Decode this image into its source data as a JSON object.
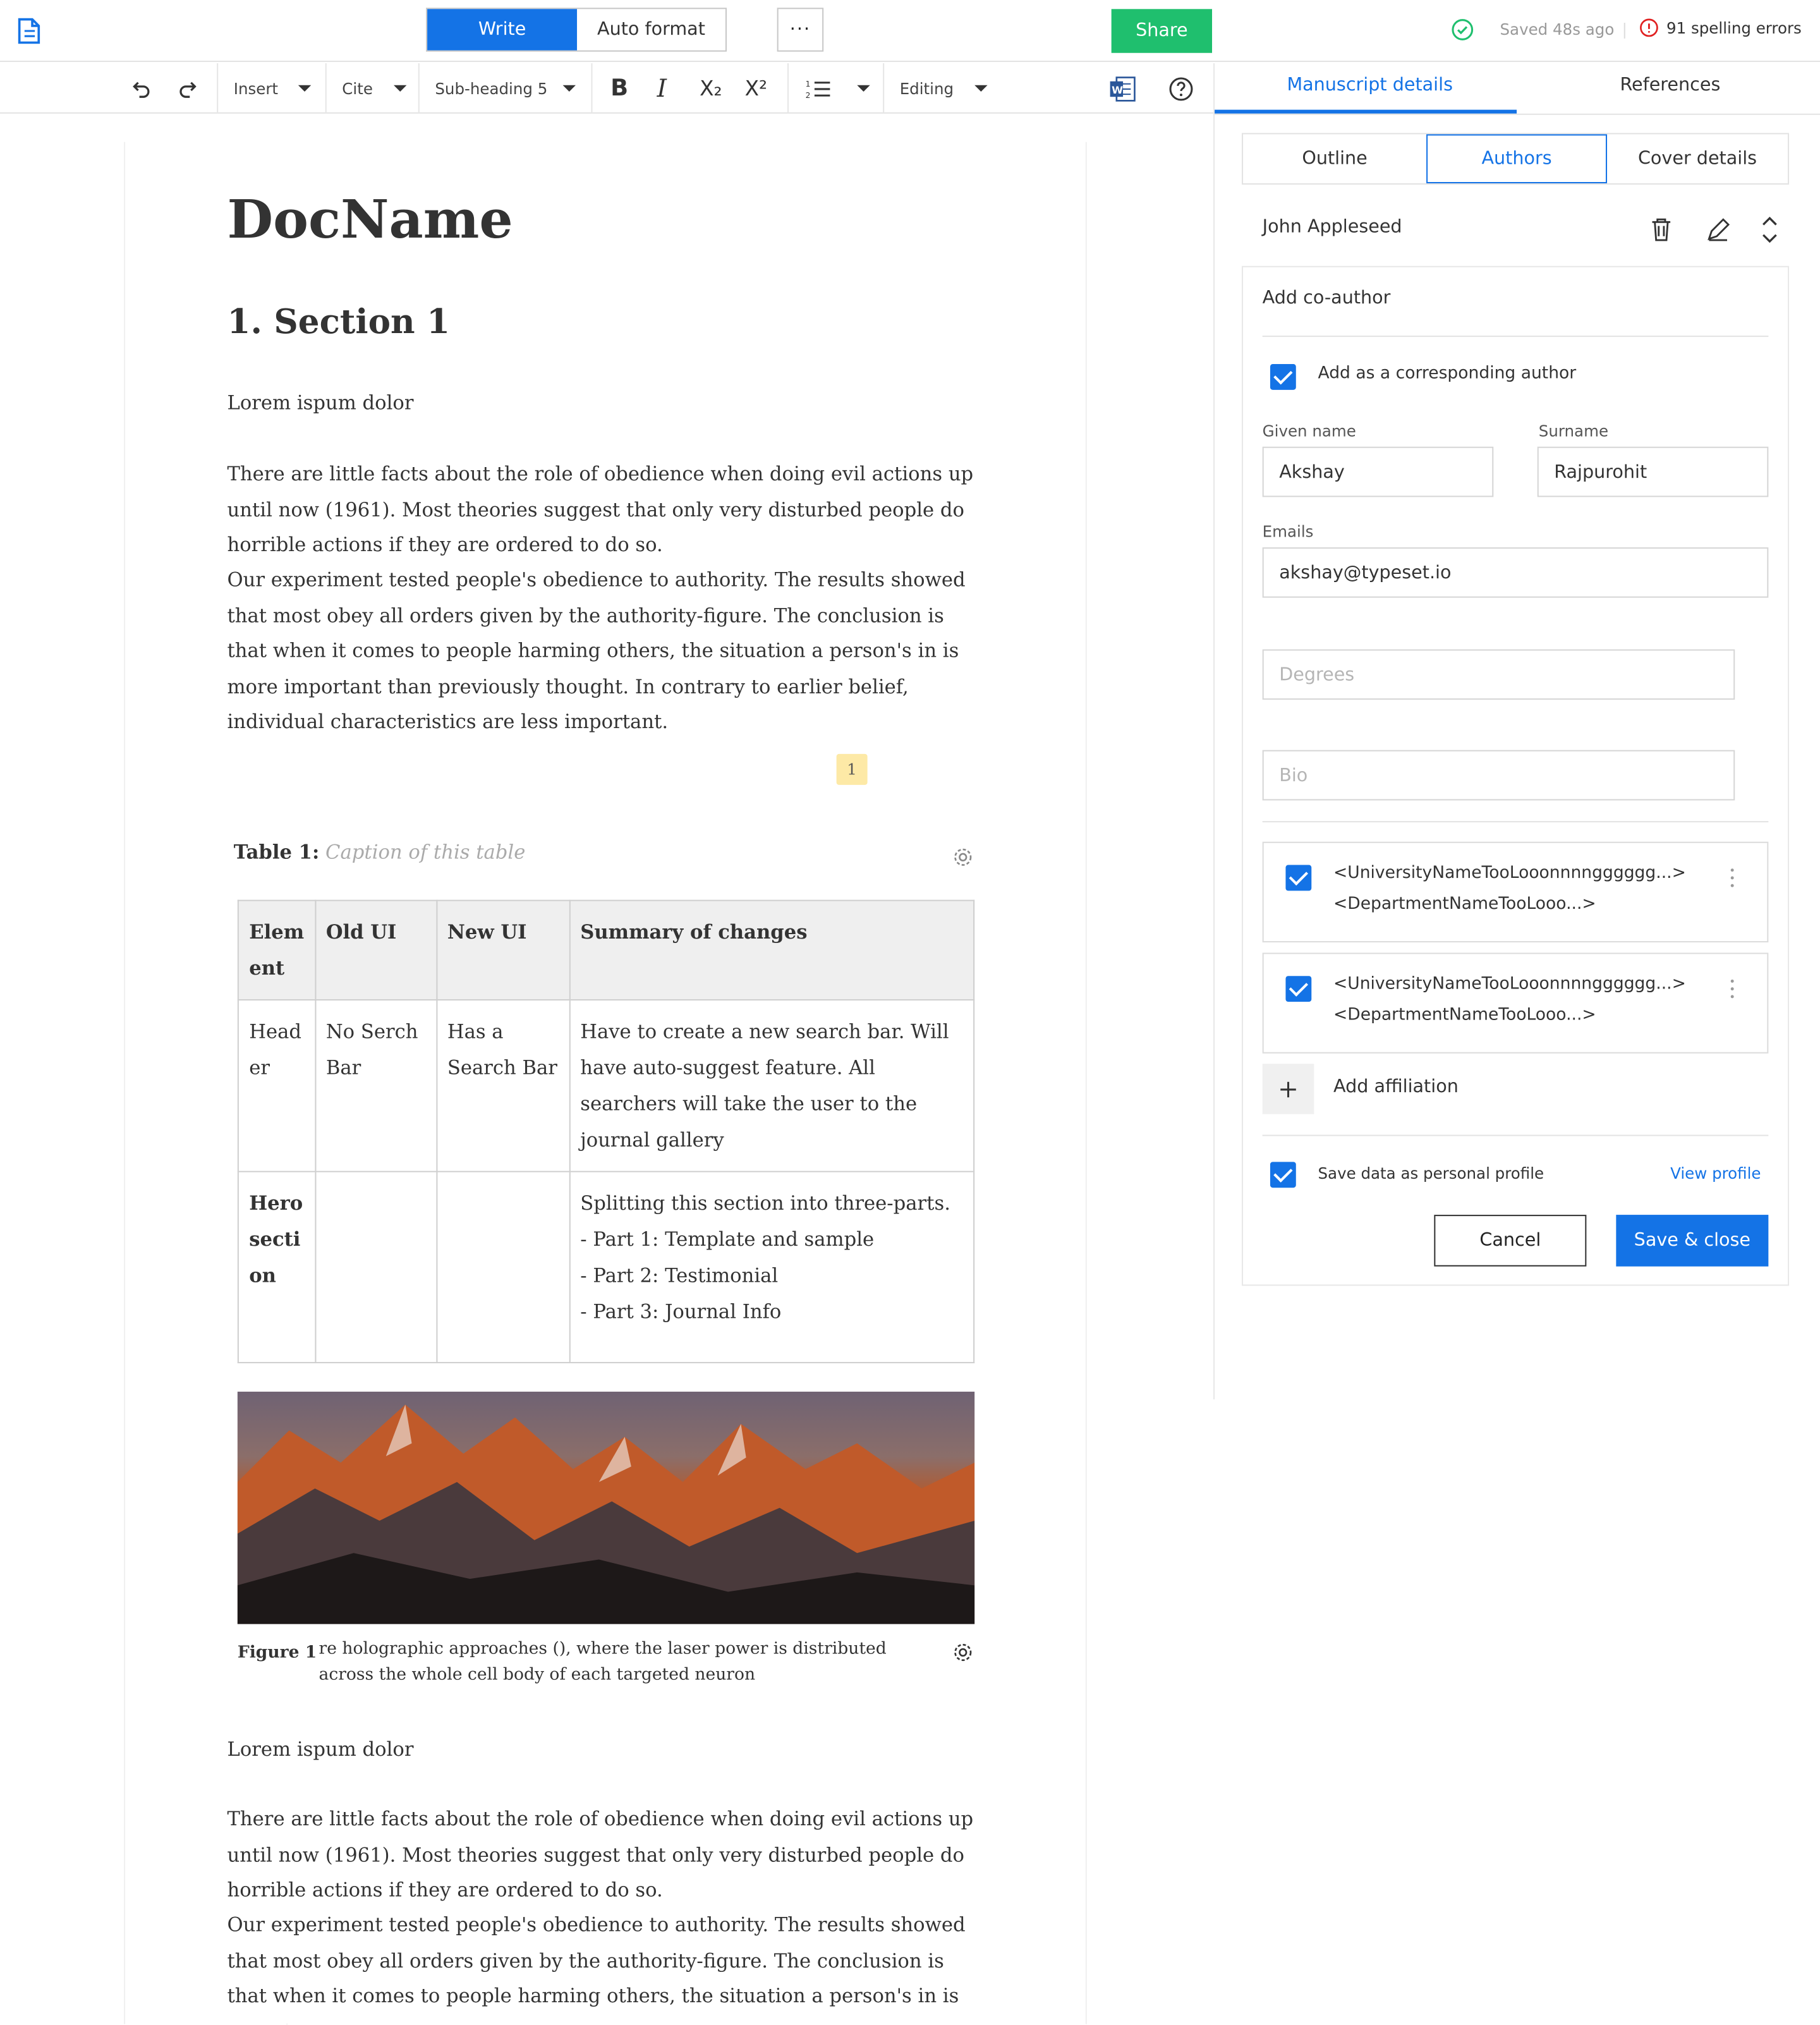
{
  "topbar": {
    "write_label": "Write",
    "autoformat_label": "Auto format",
    "more_label": "···",
    "share_label": "Share",
    "saved_text": "Saved 48s ago",
    "errors_text": "91 spelling errors"
  },
  "toolbar": {
    "insert_label": "Insert",
    "cite_label": "Cite",
    "style_label": "Sub-heading 5",
    "bold_label": "B",
    "italic_label": "I",
    "sub_label": "X₂",
    "sup_label": "X²",
    "mode_label": "Editing"
  },
  "document": {
    "title": "DocName",
    "section_heading": "1. Section 1",
    "para1": "Lorem ispum dolor",
    "para2": "There are little facts about the role of obedience when doing evil actions up until now (1961). Most theories suggest that only very disturbed people do horrible actions if they are ordered to do so.",
    "para3": "Our experiment tested people's obedience to authority. The results showed that most obey all orders given by the authority-figure. The conclusion is that when it comes to people harming others, the situation a person's in is more important than previously thought. In contrary to earlier belief, individual characteristics are less important.",
    "comment_count": "1",
    "table_label": "Table 1:",
    "table_caption_placeholder": "Caption of this table",
    "table": {
      "headers": [
        "Elem ent",
        "Old UI",
        "New UI",
        "Summary of changes"
      ],
      "rows": [
        [
          "Head er",
          "No Serch Bar",
          "Has a Search Bar",
          "Have to create a new search bar. Will have auto-suggest feature. All searchers will take the user to the journal gallery"
        ],
        [
          "Hero secti on",
          "",
          "",
          "Splitting this section into three-parts."
        ]
      ],
      "hero_parts": [
        "- Part 1: Template and sample",
        "- Part 2: Testimonial",
        "- Part 3: Journal Info"
      ]
    },
    "figure_label": "Figure 1",
    "figure_caption": "re holographic approaches (), where the laser power is distributed across the whole cell body of each targeted neuron",
    "para4": "Lorem ispum dolor",
    "para5": "There are little facts about the role of obedience when doing evil actions up until now (1961). Most theories suggest that only very disturbed people do horrible actions if they are ordered to do so.",
    "para6": "Our experiment tested people's obedience to authority. The results showed that most obey all orders given by the authority-figure. The conclusion is that when it comes to people harming others, the situation a person's in is more important"
  },
  "panel": {
    "tab_manuscript": "Manuscript details",
    "tab_references": "References",
    "subtab_outline": "Outline",
    "subtab_authors": "Authors",
    "subtab_cover": "Cover details",
    "existing_author": "John Appleseed",
    "form_title": "Add co-author",
    "corresponding_label": "Add as a corresponding author",
    "given_label": "Given name",
    "given_value": "Akshay",
    "surname_label": "Surname",
    "surname_value": "Rajpurohit",
    "emails_label": "Emails",
    "email_value": "akshay@typeset.io",
    "degrees_placeholder": "Degrees",
    "bio_placeholder": "Bio",
    "affiliations": [
      {
        "university": "<UniversityNameTooLooonnnngggggg...>",
        "department": "<DepartmentNameTooLooo...>"
      },
      {
        "university": "<UniversityNameTooLooonnnngggggg...>",
        "department": "<DepartmentNameTooLooo...>"
      }
    ],
    "add_affiliation": "Add affiliation",
    "save_profile_label": "Save data as personal profile",
    "view_profile": "View profile",
    "cancel_label": "Cancel",
    "save_label": "Save & close"
  },
  "colors": {
    "accent": "#1473e6",
    "share": "#1fbf6e",
    "error": "#e02020",
    "success": "#1fbf6e"
  }
}
